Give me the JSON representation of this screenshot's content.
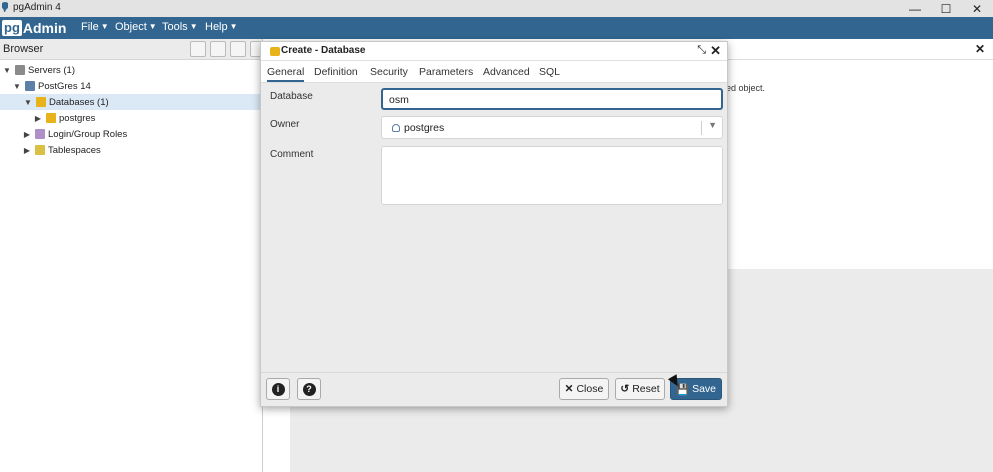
{
  "window": {
    "title": "pgAdmin 4",
    "app_icon": "elephant-icon",
    "controls": [
      "minimize-icon",
      "maximize-icon",
      "close-icon"
    ]
  },
  "menubar": {
    "logo_pg": "pg",
    "logo_admin": "Admin",
    "items": [
      {
        "label": "File"
      },
      {
        "label": "Object"
      },
      {
        "label": "Tools"
      },
      {
        "label": "Help"
      }
    ],
    "background": "#326690"
  },
  "browser": {
    "title": "Browser",
    "toolbar_icons": [
      "query-tool-icon",
      "view-data-icon",
      "filter-icon",
      "search-icon"
    ],
    "tree": [
      {
        "label": "Servers (1)",
        "icon": "server-group-icon",
        "expanded": true
      },
      {
        "label": "PostGres 14",
        "icon": "server-icon",
        "expanded": true
      },
      {
        "label": "Databases (1)",
        "icon": "databases-icon",
        "expanded": true,
        "selected": true
      },
      {
        "label": "postgres",
        "icon": "database-icon",
        "expanded": false
      },
      {
        "label": "Login/Group Roles",
        "icon": "roles-icon",
        "expanded": false
      },
      {
        "label": "Tablespaces",
        "icon": "tablespaces-icon",
        "expanded": false
      }
    ]
  },
  "rightpane": {
    "message": "ed object."
  },
  "dialog": {
    "title": "Create - Database",
    "tabs": [
      {
        "label": "General",
        "active": true
      },
      {
        "label": "Definition"
      },
      {
        "label": "Security"
      },
      {
        "label": "Parameters"
      },
      {
        "label": "Advanced"
      },
      {
        "label": "SQL"
      }
    ],
    "fields": {
      "database_label": "Database",
      "database_value": "osm",
      "owner_label": "Owner",
      "owner_value": "postgres",
      "comment_label": "Comment",
      "comment_value": ""
    },
    "footer": {
      "info_icon": "info-icon",
      "help_icon": "help-icon",
      "close_label": "Close",
      "reset_label": "Reset",
      "save_label": "Save"
    }
  }
}
